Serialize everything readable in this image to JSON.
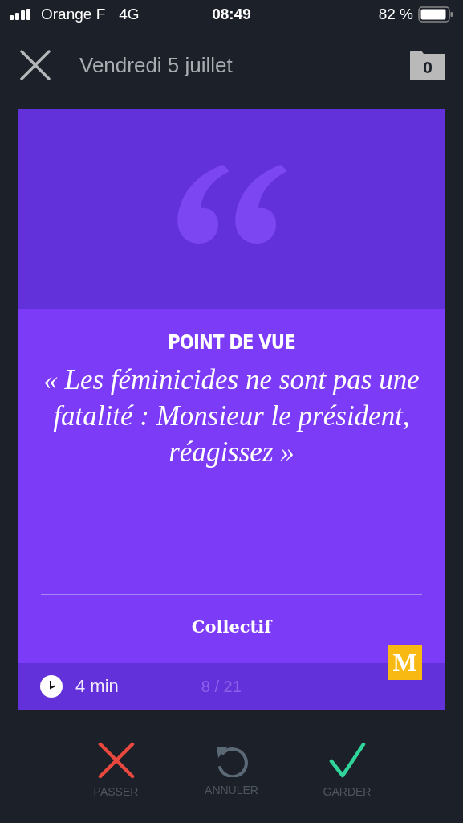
{
  "status_bar": {
    "carrier": "Orange F",
    "network": "4G",
    "time": "08:49",
    "battery_text": "82 %"
  },
  "header": {
    "title": "Vendredi 5 juillet",
    "saved_count": "0"
  },
  "card": {
    "rubric": "POINT DE VUE",
    "headline": "« Les féminicides ne sont pas une fatalité : Monsieur le président, réagissez »",
    "author": "Collectif",
    "logo": "M",
    "reading_time": "4 min",
    "position": "8 / 21"
  },
  "actions": [
    {
      "kind": "skip",
      "label": "PASSER"
    },
    {
      "kind": "undo",
      "label": "ANNULER"
    },
    {
      "kind": "keep",
      "label": "GARDER"
    }
  ]
}
